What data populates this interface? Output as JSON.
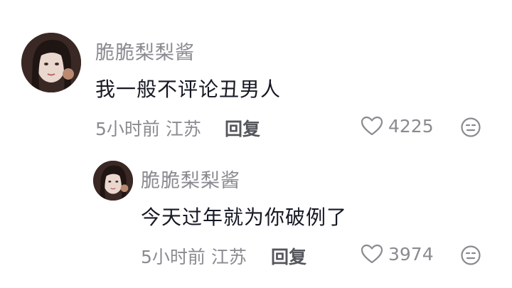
{
  "comments": [
    {
      "username": "脆脆梨梨酱",
      "text": "我一般不评论丑男人",
      "time": "5小时前",
      "location": "江苏",
      "reply_label": "回复",
      "likes": "4225",
      "like_icon": "heart-outline-icon",
      "dislike_icon": "meh-face-icon"
    },
    {
      "username": "脆脆梨梨酱",
      "text": "今天过年就为你破例了",
      "time": "5小时前",
      "location": "江苏",
      "reply_label": "回复",
      "likes": "3974",
      "like_icon": "heart-outline-icon",
      "dislike_icon": "meh-face-icon"
    }
  ],
  "colors": {
    "text_primary": "#161823",
    "text_secondary": "#8a8b91",
    "reply": "#55565c"
  }
}
